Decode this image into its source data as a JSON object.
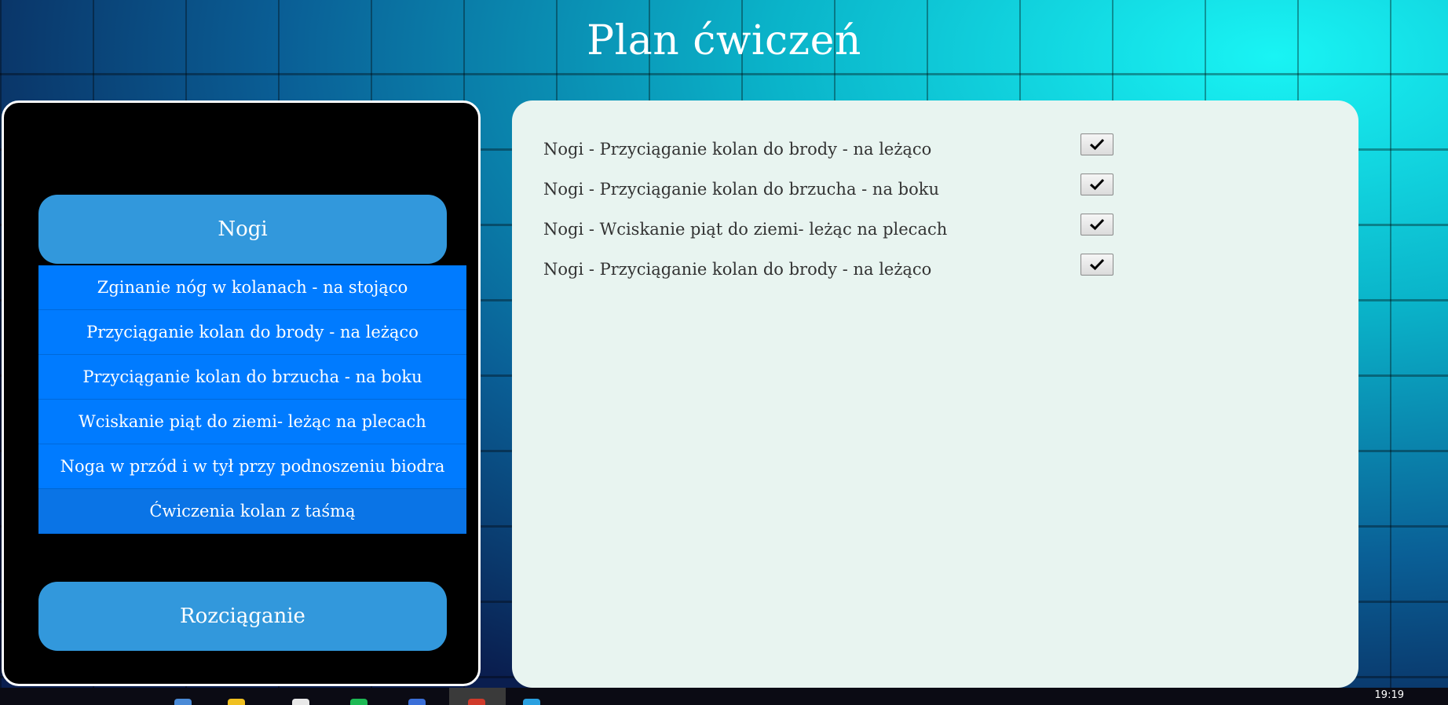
{
  "page": {
    "title": "Plan ćwiczeń"
  },
  "categories": [
    {
      "label": "Nogi"
    },
    {
      "label": "Rozciąganie"
    }
  ],
  "dropdown": {
    "items": [
      {
        "label": "Zginanie nóg w kolanach - na stojąco"
      },
      {
        "label": "Przyciąganie kolan do brody - na leżąco"
      },
      {
        "label": "Przyciąganie kolan do brzucha - na boku"
      },
      {
        "label": "Wciskanie piąt do ziemi- leżąc na plecach"
      },
      {
        "label": "Noga w przód i w tył przy podnoszeniu biodra"
      },
      {
        "label": "Ćwiczenia kolan z taśmą"
      }
    ]
  },
  "plan": {
    "exercises": [
      {
        "label": "Nogi - Przyciąganie kolan do brody - na leżąco",
        "button_icon": "check-icon"
      },
      {
        "label": "Nogi - Przyciąganie kolan do brzucha - na boku",
        "button_icon": "check-icon"
      },
      {
        "label": "Nogi - Wciskanie piąt do ziemi- leżąc na plecach",
        "button_icon": "check-icon"
      },
      {
        "label": "Nogi - Przyciąganie kolan do brody - na leżąco",
        "button_icon": "check-icon"
      }
    ]
  },
  "taskbar": {
    "time": "19:19"
  },
  "colors": {
    "category_button": "#3298dc",
    "dropdown_item": "#007bff",
    "left_panel_bg": "#000000",
    "right_panel_bg": "#e8f4f0"
  }
}
